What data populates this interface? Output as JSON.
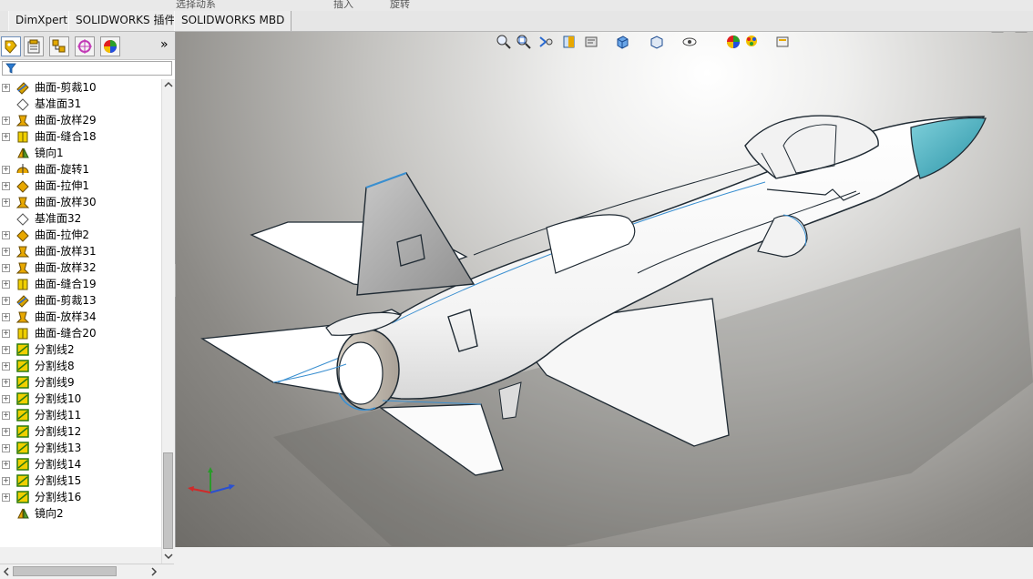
{
  "top_strip": {
    "frag1": "选择动系",
    "frag2": "插入",
    "frag3": "旋转"
  },
  "tabs": [
    {
      "label": "DimXpert"
    },
    {
      "label": "SOLIDWORKS 插件"
    },
    {
      "label": "SOLIDWORKS MBD"
    }
  ],
  "panel": {
    "expand_glyph": "»",
    "tabs": [
      {
        "icon": "feature-manager-icon"
      },
      {
        "icon": "property-manager-icon"
      },
      {
        "icon": "configuration-manager-icon"
      },
      {
        "icon": "dimxpert-manager-icon"
      },
      {
        "icon": "display-manager-icon"
      }
    ],
    "filter_icon": "filter-icon",
    "tree": [
      {
        "label": "曲面-剪裁10",
        "icon": "surface-trim-icon",
        "expandable": true
      },
      {
        "label": "基准面31",
        "icon": "plane-icon",
        "expandable": false
      },
      {
        "label": "曲面-放样29",
        "icon": "surface-loft-icon",
        "expandable": true
      },
      {
        "label": "曲面-缝合18",
        "icon": "surface-knit-icon",
        "expandable": true
      },
      {
        "label": "镜向1",
        "icon": "mirror-icon",
        "expandable": false
      },
      {
        "label": "曲面-旋转1",
        "icon": "surface-revolve-icon",
        "expandable": true
      },
      {
        "label": "曲面-拉伸1",
        "icon": "surface-extrude-icon",
        "expandable": true
      },
      {
        "label": "曲面-放样30",
        "icon": "surface-loft-icon",
        "expandable": true
      },
      {
        "label": "基准面32",
        "icon": "plane-icon",
        "expandable": false
      },
      {
        "label": "曲面-拉伸2",
        "icon": "surface-extrude-icon",
        "expandable": true
      },
      {
        "label": "曲面-放样31",
        "icon": "surface-loft-icon",
        "expandable": true
      },
      {
        "label": "曲面-放样32",
        "icon": "surface-loft-icon",
        "expandable": true
      },
      {
        "label": "曲面-缝合19",
        "icon": "surface-knit-icon",
        "expandable": true
      },
      {
        "label": "曲面-剪裁13",
        "icon": "surface-trim-icon",
        "expandable": true
      },
      {
        "label": "曲面-放样34",
        "icon": "surface-loft-icon",
        "expandable": true
      },
      {
        "label": "曲面-缝合20",
        "icon": "surface-knit-icon",
        "expandable": true
      },
      {
        "label": "分割线2",
        "icon": "split-line-icon",
        "expandable": true
      },
      {
        "label": "分割线8",
        "icon": "split-line-icon",
        "expandable": true
      },
      {
        "label": "分割线9",
        "icon": "split-line-icon",
        "expandable": true
      },
      {
        "label": "分割线10",
        "icon": "split-line-icon",
        "expandable": true
      },
      {
        "label": "分割线11",
        "icon": "split-line-icon",
        "expandable": true
      },
      {
        "label": "分割线12",
        "icon": "split-line-icon",
        "expandable": true
      },
      {
        "label": "分割线13",
        "icon": "split-line-icon",
        "expandable": true
      },
      {
        "label": "分割线14",
        "icon": "split-line-icon",
        "expandable": true
      },
      {
        "label": "分割线15",
        "icon": "split-line-icon",
        "expandable": true
      },
      {
        "label": "分割线16",
        "icon": "split-line-icon",
        "expandable": true
      },
      {
        "label": "镜向2",
        "icon": "mirror-icon",
        "expandable": false
      }
    ]
  },
  "view_toolbar": [
    {
      "icon": "zoom-to-fit-icon"
    },
    {
      "icon": "zoom-to-area-icon"
    },
    {
      "icon": "previous-view-icon"
    },
    {
      "icon": "section-view-icon"
    },
    {
      "icon": "dynamic-annotation-icon"
    },
    {
      "icon": "view-orientation-icon"
    },
    {
      "icon": "display-style-icon"
    },
    {
      "icon": "hide-show-items-icon"
    },
    {
      "icon": "edit-appearance-icon"
    },
    {
      "icon": "apply-scene-icon"
    },
    {
      "icon": "view-settings-icon"
    }
  ],
  "viewport": {
    "model": "jet-fighter-surface-model",
    "triad_axes": [
      "x",
      "y",
      "z"
    ],
    "colors": {
      "body": "#ffffff",
      "nose": "#3aa9b8",
      "edge": "#1f2a33",
      "tangent_edge": "#3a8fd0"
    }
  }
}
